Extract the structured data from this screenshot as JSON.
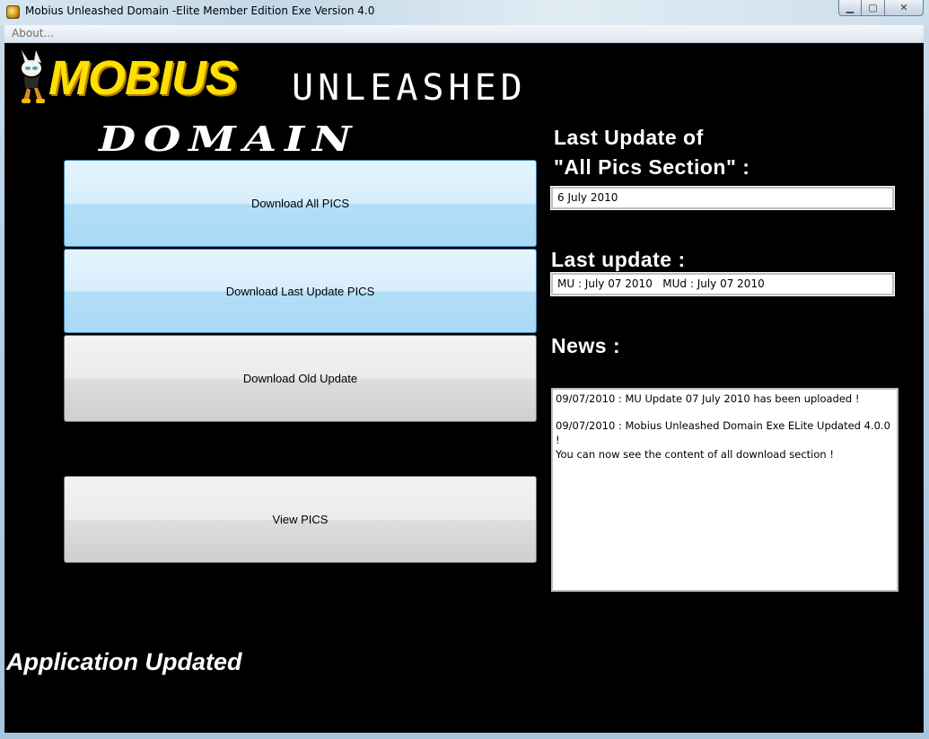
{
  "window": {
    "title": "Mobius Unleashed Domain -Elite Member Edition Exe Version 4.0",
    "minimize_glyph": "▁",
    "maximize_glyph": "▢",
    "close_glyph": "✕"
  },
  "menu": {
    "about_label": "About..."
  },
  "logo": {
    "mobius": "MOBIUS",
    "unleashed": "UNLEASHED",
    "domain": "DOMAIN"
  },
  "buttons": {
    "download_all": "Download All PICS",
    "download_last": "Download Last Update PICS",
    "download_old": "Download Old Update",
    "view_pics": "View PICS"
  },
  "last_update_all": {
    "label_line1": "Last Update of",
    "label_line2": "\"All Pics Section\" :",
    "value": "6 July 2010"
  },
  "last_update": {
    "label": "Last update :",
    "value": "MU : July 07 2010   MUd : July 07 2010"
  },
  "news": {
    "label": "News :",
    "items": [
      "09/07/2010 : MU Update 07 July 2010 has been uploaded !",
      "09/07/2010 : Mobius Unleashed Domain Exe ELite Updated 4.0.0 !",
      "You can now see the content of all download section !"
    ]
  },
  "status": {
    "text": "Application Updated"
  },
  "colors": {
    "client_bg": "#000000",
    "logo_yellow": "#ffe000",
    "button_blue": "#b3def7",
    "button_gray": "#dddddd"
  }
}
